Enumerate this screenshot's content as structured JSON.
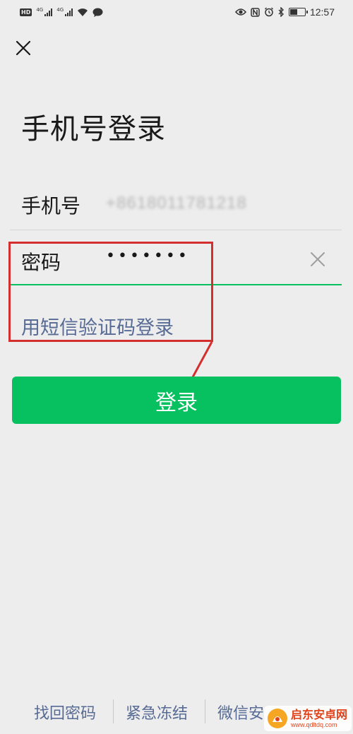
{
  "status_bar": {
    "left_badges": [
      "HD",
      "4G",
      "4G"
    ],
    "time": "12:57",
    "icons": [
      "eye-icon",
      "nfc-icon",
      "alarm-icon",
      "bluetooth-icon",
      "battery-icon"
    ],
    "battery_level": 0.5
  },
  "header": {
    "close_icon": "close-icon",
    "title": "手机号登录"
  },
  "form": {
    "phone_label": "手机号",
    "phone_value": "+8618011781218",
    "password_label": "密码",
    "password_value": "•••••••",
    "clear_icon": "clear-icon",
    "sms_login_link": "用短信验证码登录"
  },
  "login_button": "登录",
  "footer": {
    "links": [
      "找回密码",
      "紧急冻结",
      "微信安"
    ]
  },
  "watermark": {
    "name": "启东安卓网",
    "url": "www.qdltdq.com"
  },
  "colors": {
    "background": "#ededed",
    "accent_green": "#07c160",
    "link_blue": "#576b95",
    "annotation_red": "#d32f2f"
  }
}
